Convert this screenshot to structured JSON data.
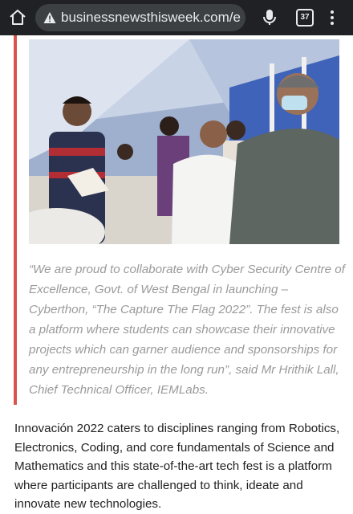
{
  "browser": {
    "url": "businessnewsthisweek.com/e",
    "tab_count": "37",
    "icons": {
      "home": "home-icon",
      "security": "not-secure-warning-icon",
      "mic": "mic-icon",
      "tabs": "tab-switcher-icon",
      "menu": "overflow-menu-icon"
    }
  },
  "article": {
    "photo": "event-photo",
    "quote": "“We are proud to collaborate with Cyber Security Centre of Excellence, Govt. of West Bengal in launching – Cyberthon, “The Capture The Flag 2022”. The fest is also a platform where students can showcase their innovative projects which can garner audience and sponsorships for any entrepreneurship in the long run”, said Mr Hrithik Lall, Chief Technical Officer, IEMLabs.",
    "paragraph": "Innovación 2022 caters to disciplines ranging from Robotics, Electronics, Coding, and core fundamentals of Science and Mathematics and this state-of-the-art tech fest is a platform where participants are challenged to think, ideate and innovate new technologies."
  },
  "colors": {
    "chrome_bg": "#202124",
    "urlbar_bg": "#3c4043",
    "quote_accent": "#d9534f",
    "quote_text": "#9a9a9a",
    "body_text": "#222222"
  }
}
